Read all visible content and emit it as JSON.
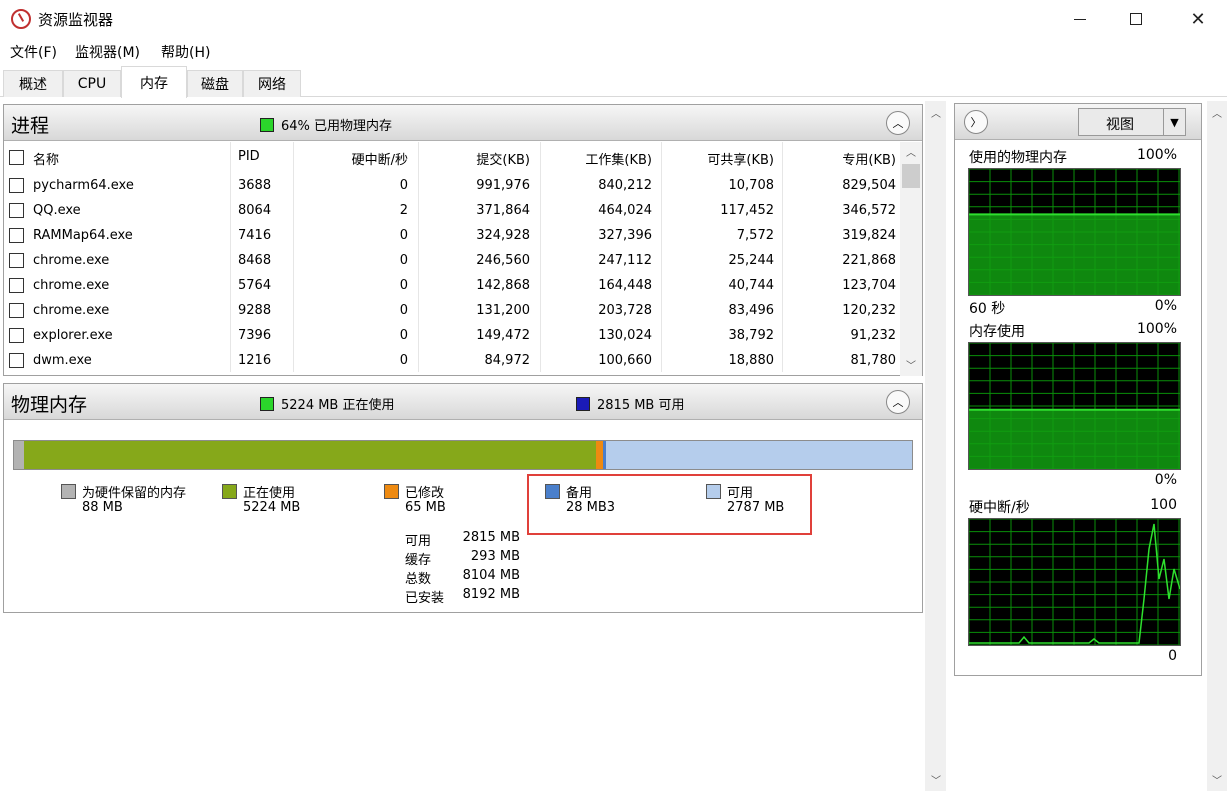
{
  "window": {
    "title": "资源监视器",
    "minimize": "—",
    "close": "✕"
  },
  "menu": [
    "文件(F)",
    "监视器(M)",
    "帮助(H)"
  ],
  "tabs": [
    "概述",
    "CPU",
    "内存",
    "磁盘",
    "网络"
  ],
  "active_tab": "内存",
  "processes": {
    "title": "进程",
    "usage_text": "64% 已用物理内存",
    "usage_color": "#2bd52b",
    "columns": [
      "名称",
      "PID",
      "硬中断/秒",
      "提交(KB)",
      "工作集(KB)",
      "可共享(KB)",
      "专用(KB)"
    ],
    "rows": [
      [
        "pycharm64.exe",
        "3688",
        "0",
        "991,976",
        "840,212",
        "10,708",
        "829,504"
      ],
      [
        "QQ.exe",
        "8064",
        "2",
        "371,864",
        "464,024",
        "117,452",
        "346,572"
      ],
      [
        "RAMMap64.exe",
        "7416",
        "0",
        "324,928",
        "327,396",
        "7,572",
        "319,824"
      ],
      [
        "chrome.exe",
        "8468",
        "0",
        "246,560",
        "247,112",
        "25,244",
        "221,868"
      ],
      [
        "chrome.exe",
        "5764",
        "0",
        "142,868",
        "164,448",
        "40,744",
        "123,704"
      ],
      [
        "chrome.exe",
        "9288",
        "0",
        "131,200",
        "203,728",
        "83,496",
        "120,232"
      ],
      [
        "explorer.exe",
        "7396",
        "0",
        "149,472",
        "130,024",
        "38,792",
        "91,232"
      ],
      [
        "dwm.exe",
        "1216",
        "0",
        "84,972",
        "100,660",
        "18,880",
        "81,780"
      ]
    ]
  },
  "physical_memory": {
    "title": "物理内存",
    "in_use_text": "5224 MB 正在使用",
    "available_text": "2815 MB 可用",
    "in_use_color": "#2bd52b",
    "available_color": "#1a1ab8",
    "bar_fractions": {
      "reserved": 0.0107,
      "in_use": 0.6377,
      "modified": 0.0079,
      "standby": 0.0034,
      "free": 0.3403
    },
    "legend": [
      {
        "label": "为硬件保留的内存",
        "value": "88 MB",
        "color": "#b3b3b3"
      },
      {
        "label": "正在使用",
        "value": "5224 MB",
        "color": "#86a81a"
      },
      {
        "label": "已修改",
        "value": "65 MB",
        "color": "#ee8a11"
      },
      {
        "label": "备用",
        "value": "28 MB3",
        "color": "#4a7fcb"
      },
      {
        "label": "可用",
        "value": "2787 MB",
        "color": "#b5cdec"
      }
    ],
    "stats": [
      {
        "label": "可用",
        "value": "2815 MB"
      },
      {
        "label": "缓存",
        "value": "293 MB"
      },
      {
        "label": "总数",
        "value": "8104 MB"
      },
      {
        "label": "已安装",
        "value": "8192 MB"
      }
    ]
  },
  "right_panel": {
    "view_label": "视图",
    "graphs": [
      {
        "title": "使用的物理内存",
        "top": "100%",
        "bottom_left": "60 秒",
        "bottom_right": "0%",
        "level": 0.64
      },
      {
        "title": "内存使用",
        "top": "100%",
        "bottom_left": "",
        "bottom_right": "0%",
        "level": 0.47
      },
      {
        "title": "硬中断/秒",
        "top": "100",
        "bottom_left": "",
        "bottom_right": "0",
        "level": 0
      }
    ]
  }
}
